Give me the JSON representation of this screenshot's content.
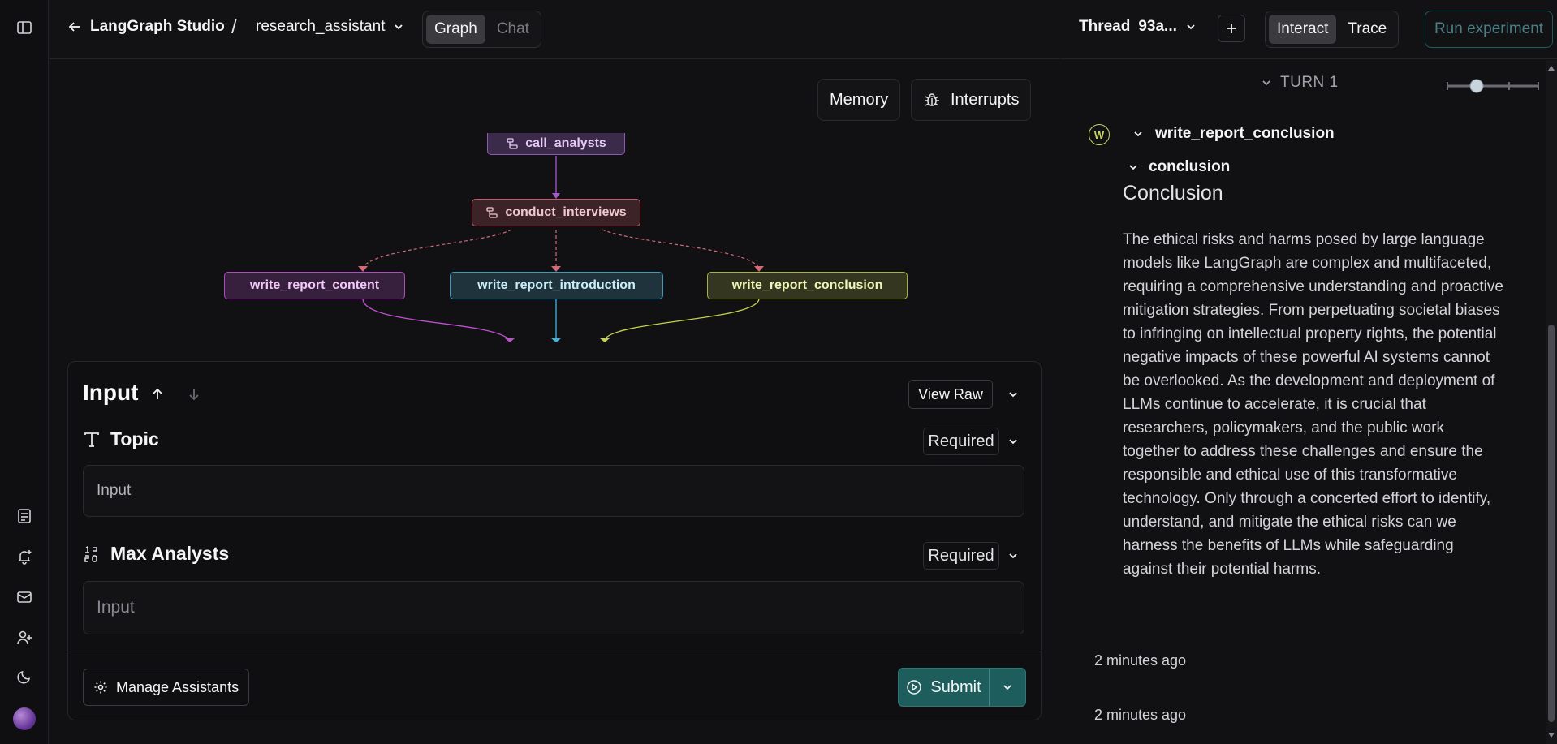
{
  "app": {
    "title": "LangGraph Studio",
    "assistant": "research_assistant",
    "view_tabs": [
      "Graph",
      "Chat"
    ]
  },
  "thread": {
    "label": "Thread",
    "id": "93a...",
    "mode_tabs": [
      "Interact",
      "Trace"
    ],
    "run_experiment": "Run experiment"
  },
  "rail": {
    "icons": [
      "sidebar-toggle-icon",
      "document-icon",
      "bell-plus-icon",
      "mail-icon",
      "user-plus-icon",
      "moon-icon",
      "avatar"
    ]
  },
  "canvas": {
    "memory_button": "Memory",
    "interrupts_button": "Interrupts",
    "nodes": {
      "call_analysts": "call_analysts",
      "conduct_interviews": "conduct_interviews",
      "write_report_content": "write_report_content",
      "write_report_introduction": "write_report_introduction",
      "write_report_conclusion": "write_report_conclusion"
    }
  },
  "input_panel": {
    "title": "Input",
    "view_raw": "View Raw",
    "fields": [
      {
        "label": "Topic",
        "badge": "Required",
        "placeholder": "Input",
        "value": ""
      },
      {
        "label": "Max Analysts",
        "badge": "Required",
        "placeholder": "Input",
        "value": ""
      }
    ],
    "manage_assistants": "Manage Assistants",
    "submit": "Submit"
  },
  "trace": {
    "turn_label": "TURN 1",
    "node_badge": "W",
    "node_name": "write_report_conclusion",
    "key": "conclusion",
    "heading": "Conclusion",
    "body": "The ethical risks and harms posed by large language models like LangGraph are complex and multifaceted, requiring a comprehensive understanding and proactive mitigation strategies. From perpetuating societal biases to infringing on intellectual property rights, the potential negative impacts of these powerful AI systems cannot be overlooked. As the development and deployment of LLMs continue to accelerate, it is crucial that researchers, policymakers, and the public work together to address these challenges and ensure the responsible and ethical use of this transformative technology. Only through a concerted effort to identify, understand, and mitigate the ethical risks can we harness the benefits of LLMs while safeguarding against their potential harms.",
    "timestamps": [
      "2 minutes ago",
      "2 minutes ago"
    ]
  },
  "colors": {
    "accent_teal": "#1d5e5d",
    "node_content": "#c04fd0",
    "node_intro": "#3fb6dd",
    "node_conclusion": "#c7d34e",
    "node_interviews": "#e0707a"
  }
}
